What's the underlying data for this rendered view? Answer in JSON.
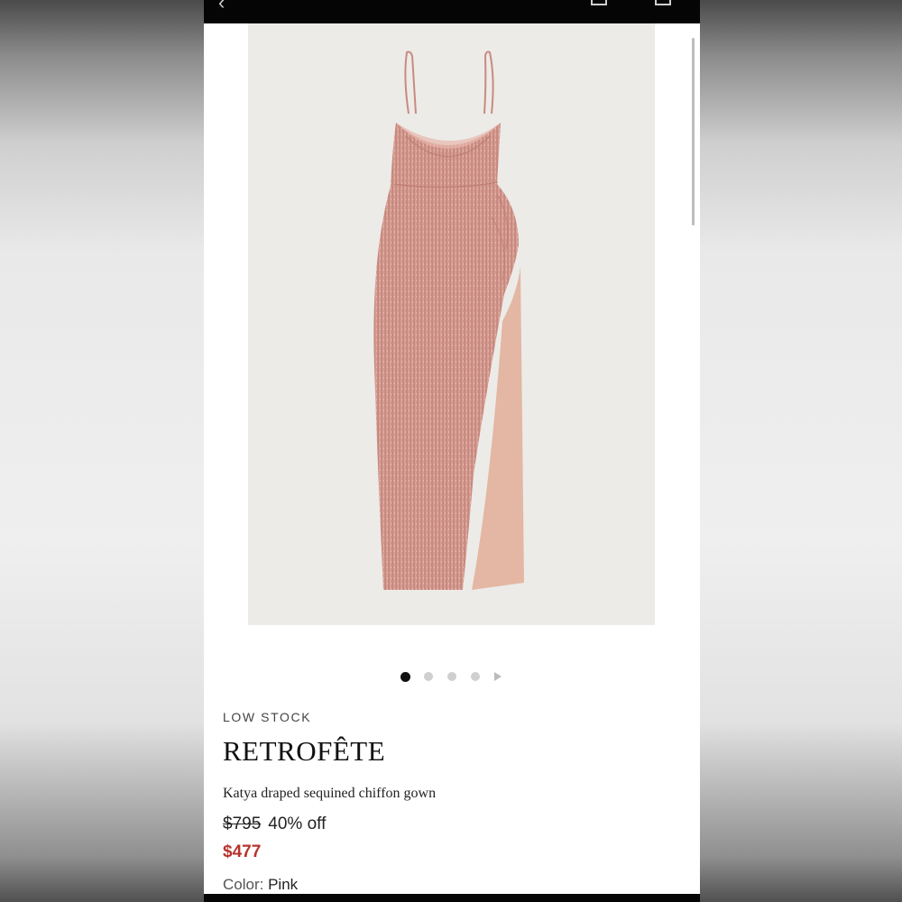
{
  "product": {
    "stock_status": "LOW STOCK",
    "brand": "RETROFÊTE",
    "name": "Katya draped sequined chiffon gown",
    "original_price": "$795",
    "discount": "40% off",
    "sale_price": "$477",
    "color_label": "Color:",
    "color_value": "Pink"
  },
  "gallery": {
    "image_count": 4,
    "active_index": 0
  },
  "icons": {
    "back": "chevron-left-icon",
    "share": "share-icon",
    "bag": "bag-icon",
    "next": "play-triangle-icon"
  },
  "colors": {
    "sale_price": "#b8322b",
    "dress": "#d49a90",
    "image_bg": "#ecebe8"
  }
}
